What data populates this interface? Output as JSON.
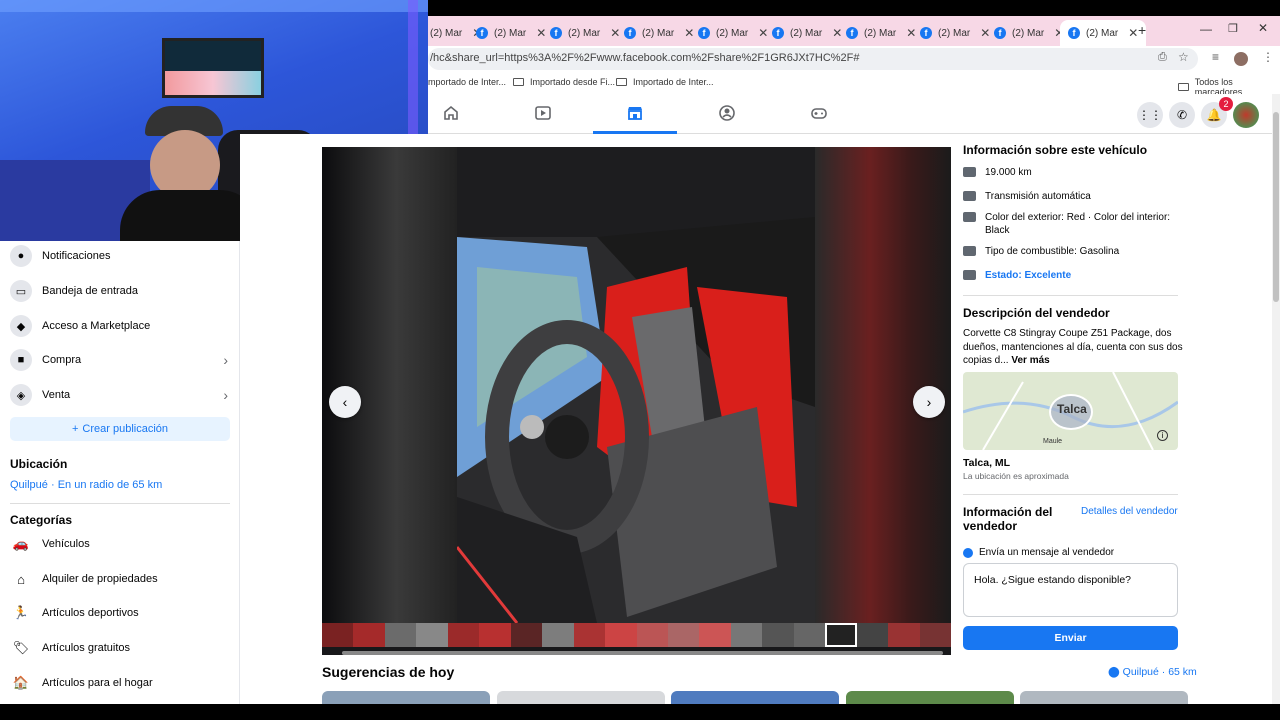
{
  "browser": {
    "tab_label": "(2) Mar",
    "tab_count_visible": 9,
    "url": "/hc&share_url=https%3A%2F%2Fwww.facebook.com%2Fshare%2F1GR6JXt7HC%2F#",
    "bookmarks": [
      "mportado de Inter...",
      "Importado desde Fi...",
      "Importado de Inter..."
    ],
    "all_bookmarks_label": "Todos los marcadores"
  },
  "fbnav": {
    "notification_count": "2"
  },
  "sidebar": {
    "items": [
      {
        "label": "Notificaciones",
        "icon": "bell-icon"
      },
      {
        "label": "Bandeja de entrada",
        "icon": "inbox-icon"
      },
      {
        "label": "Acceso a Marketplace",
        "icon": "shield-icon"
      },
      {
        "label": "Compra",
        "icon": "bag-icon"
      },
      {
        "label": "Venta",
        "icon": "tag-icon"
      }
    ],
    "create_button": "Crear publicación",
    "location_title": "Ubicación",
    "location_value": "Quilpué · En un radio de 65 km",
    "categories_title": "Categorías",
    "categories": [
      {
        "label": "Vehículos",
        "icon": "car-icon"
      },
      {
        "label": "Alquiler de propiedades",
        "icon": "house-icon"
      },
      {
        "label": "Artículos deportivos",
        "icon": "runner-icon"
      },
      {
        "label": "Artículos gratuitos",
        "icon": "gift-icon"
      },
      {
        "label": "Artículos para el hogar",
        "icon": "home-goods-icon"
      }
    ]
  },
  "vehicle_info": {
    "title": "Información sobre este vehículo",
    "mileage": "19.000 km",
    "transmission": "Transmisión automática",
    "colors_line1": "Color del exterior: Red · Color del interior:",
    "colors_line2": "Black",
    "fuel": "Tipo de combustible: Gasolina",
    "condition": "Estado: Excelente"
  },
  "seller_description": {
    "title": "Descripción del vendedor",
    "text": "Corvette C8 Stingray Coupe Z51 Package, dos dueños, mantenciones al día, cuenta con sus dos copias d...",
    "see_more": "Ver más"
  },
  "map": {
    "town_label": "Talca",
    "small_label": "Maule",
    "location": "Talca, ML",
    "note": "La ubicación es aproximada"
  },
  "seller_info": {
    "title": "Información del vendedor",
    "details_link": "Detalles del vendedor",
    "message_prompt": "Envía un mensaje al vendedor",
    "message_value": "Hola. ¿Sigue estando disponible?",
    "send_button": "Enviar"
  },
  "suggestions": {
    "title": "Sugerencias de hoy",
    "location": "Quilpué · 65 km"
  },
  "colors": {
    "accent": "#1877f2",
    "seat_red": "#e0231d"
  }
}
